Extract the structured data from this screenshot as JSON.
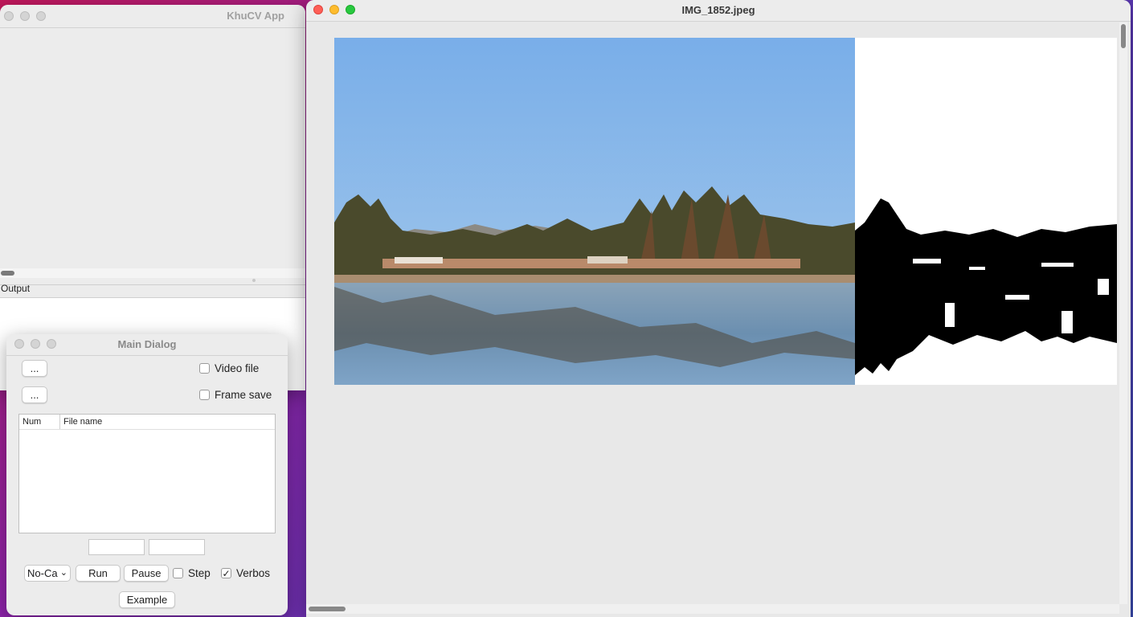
{
  "khucv": {
    "title": "KhuCV App",
    "output_label": "Output"
  },
  "main_dialog": {
    "title": "Main Dialog",
    "browse1_label": "...",
    "browse2_label": "...",
    "video_file_label": "Video file",
    "video_file_checked": false,
    "frame_save_label": "Frame save",
    "frame_save_checked": false,
    "table": {
      "columns": [
        "Num",
        "File name"
      ],
      "rows": []
    },
    "field1_value": "",
    "field2_value": "",
    "camera_select_value": "No-Ca",
    "run_label": "Run",
    "pause_label": "Pause",
    "step_label": "Step",
    "step_checked": false,
    "verbose_label": "Verbos",
    "verbose_checked": true,
    "example_label": "Example"
  },
  "image_window": {
    "title": "IMG_1852.jpeg"
  },
  "colors": {
    "sky_top": "#79aee9",
    "sky_bottom": "#a8cbea",
    "water": "#6b8fb0",
    "close_red": "#fe5f57",
    "minimize_yellow": "#febc2e",
    "zoom_green": "#28c840"
  },
  "icons": {
    "checkmark": "✓",
    "chevron": "⌄"
  }
}
